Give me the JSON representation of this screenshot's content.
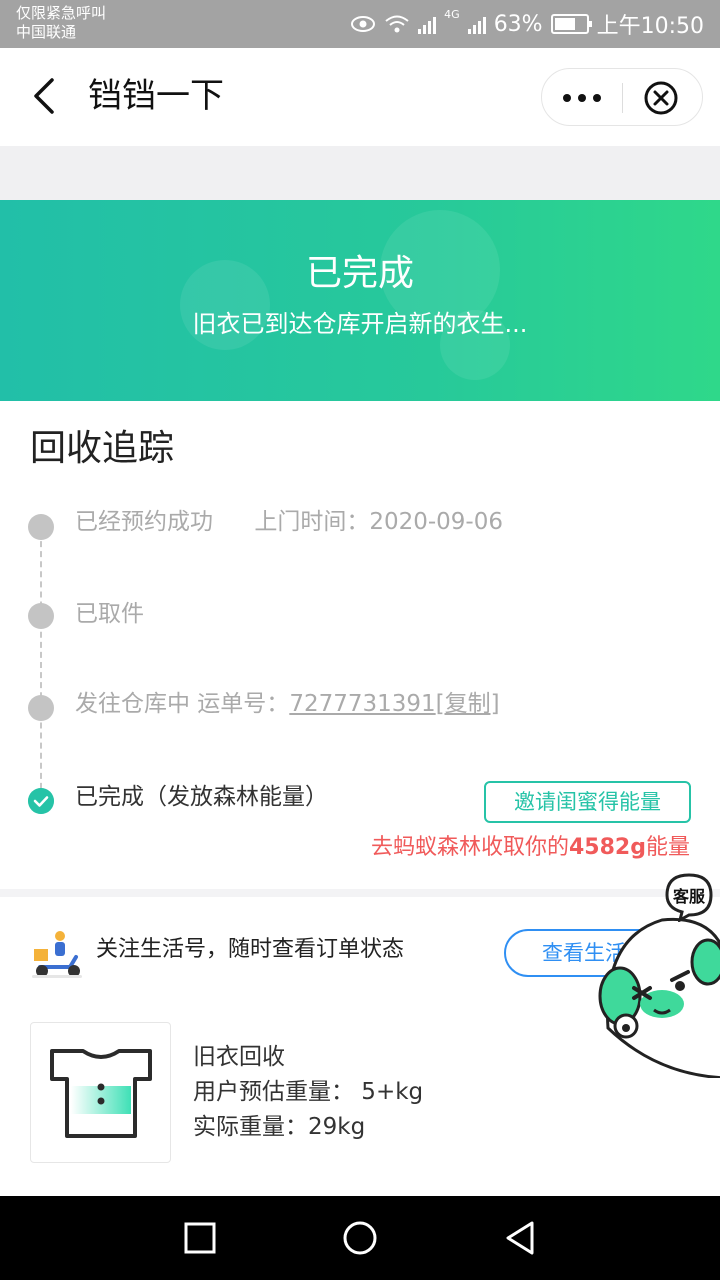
{
  "status_bar": {
    "carrier_line1": "仅限紧急呼叫",
    "carrier_line2": "中国联通",
    "network": "4G",
    "battery": "63%",
    "time": "上午10:50"
  },
  "nav": {
    "title": "铛铛一下"
  },
  "banner": {
    "status": "已完成",
    "description": "旧衣已到达仓库开启新的衣生..."
  },
  "tracking": {
    "title": "回收追踪",
    "steps": [
      {
        "label": "已经预约成功",
        "detail": "上门时间：2020-09-06"
      },
      {
        "label": "已取件"
      },
      {
        "label": "发往仓库中 运单号：",
        "waybill": "7277731391",
        "copy": "[复制]"
      },
      {
        "label": "已完成（发放森林能量）"
      }
    ],
    "invite_button": "邀请闺蜜得能量",
    "energy_prefix": "去蚂蚁森林收取你的",
    "energy_amount": "4582g",
    "energy_suffix": "能量"
  },
  "follow": {
    "text": "关注生活号，随时查看订单状态",
    "button": "查看生活号"
  },
  "item": {
    "name": "旧衣回收",
    "estimated_weight": "用户预估重量： 5+kg",
    "actual_weight": "实际重量：29kg"
  },
  "customer_service": {
    "label": "客服"
  },
  "colors": {
    "accent": "#26c3a7",
    "energy": "#f05a5a",
    "link_blue": "#2f8ff3"
  }
}
